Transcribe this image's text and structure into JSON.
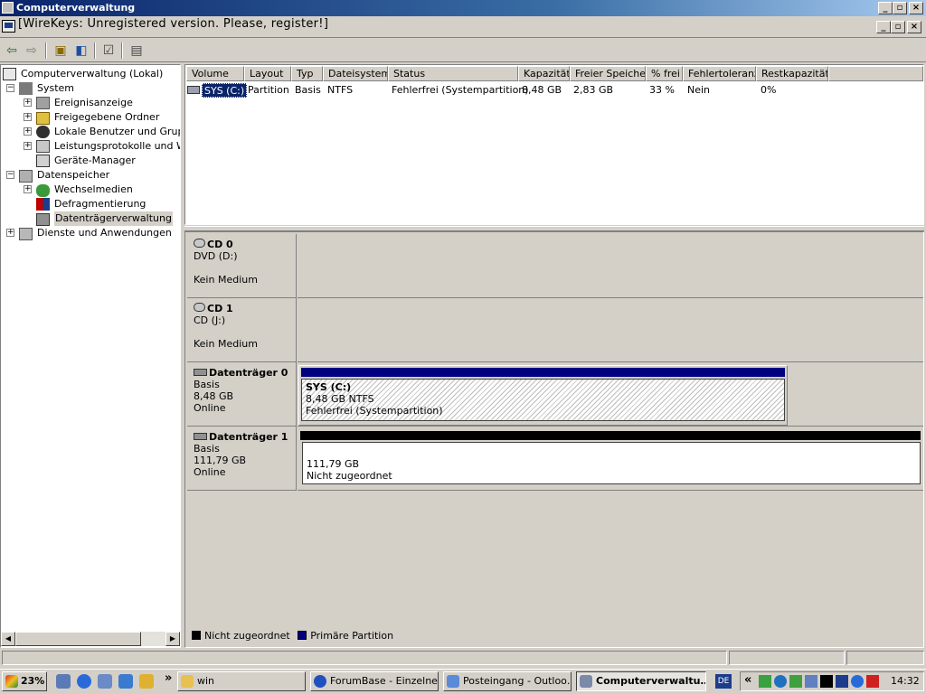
{
  "window": {
    "title": "Computerverwaltung"
  },
  "menubar": {
    "registration_notice": "[WireKeys: Unregistered version. Please, register!]"
  },
  "toolbar": {
    "icons": [
      "back-arrow-icon",
      "forward-arrow-icon",
      "up-folder-icon",
      "show-hide-tree-icon",
      "properties-icon",
      "help-icon"
    ]
  },
  "tree": {
    "root": "Computerverwaltung (Lokal)",
    "system": "System",
    "ereignisanzeige": "Ereignisanzeige",
    "freigegebene_ordner": "Freigegebene Ordner",
    "lokale_benutzer": "Lokale Benutzer und Gruppen",
    "leistungsprotokolle": "Leistungsprotokolle und Warnungen",
    "geraete_manager": "Geräte-Manager",
    "datenspeicher": "Datenspeicher",
    "wechselmedien": "Wechselmedien",
    "defragmentierung": "Defragmentierung",
    "datentraegerverwaltung": "Datenträgerverwaltung",
    "dienste": "Dienste und Anwendungen"
  },
  "volumes": {
    "columns": [
      "Volume",
      "Layout",
      "Typ",
      "Dateisystem",
      "Status",
      "Kapazität",
      "Freier Speicher",
      "% frei",
      "Fehlertoleranz",
      "Restkapazität"
    ],
    "rows": [
      [
        "SYS (C:)",
        "Partition",
        "Basis",
        "NTFS",
        "Fehlerfrei (Systempartition)",
        "8,48 GB",
        "2,83 GB",
        "33 %",
        "Nein",
        "0%"
      ]
    ]
  },
  "disks": [
    {
      "name": "CD 0",
      "line1": "DVD (D:)",
      "line2": "",
      "line3": "Kein Medium"
    },
    {
      "name": "CD 1",
      "line1": "CD (J:)",
      "line2": "",
      "line3": "Kein Medium"
    },
    {
      "name": "Datenträger 0",
      "line1": "Basis",
      "line2": "8,48 GB",
      "line3": "Online",
      "partition": {
        "name": "SYS  (C:)",
        "size": "8,48 GB NTFS",
        "status": "Fehlerfrei (Systempartition)"
      }
    },
    {
      "name": "Datenträger 1",
      "line1": "Basis",
      "line2": "111,79 GB",
      "line3": "Online",
      "partition": {
        "size": "111,79 GB",
        "status": "Nicht zugeordnet"
      }
    }
  ],
  "legend": {
    "unallocated": "Nicht zugeordnet",
    "primary": "Primäre Partition",
    "unallocated_color": "#000000",
    "primary_color": "#000080"
  },
  "taskbar": {
    "cpu": "23%",
    "chevron": "»",
    "buttons": [
      "win",
      "ForumBase - Einzelne…",
      "Posteingang - Outloo…",
      "Computerverwaltu…"
    ],
    "lang": "DE",
    "tray_chevron": "«",
    "clock": "14:32"
  }
}
